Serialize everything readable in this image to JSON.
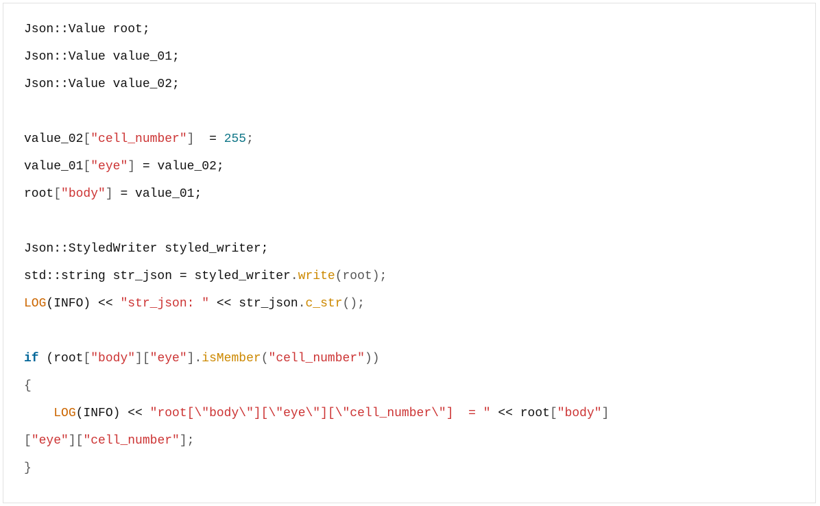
{
  "code": {
    "l1": {
      "a": "Json::Value root;"
    },
    "l2": {
      "a": "Json::Value value_01;"
    },
    "l3": {
      "a": "Json::Value value_02;"
    },
    "l4": {
      "a": ""
    },
    "l5": {
      "a": "value_02",
      "b": "[",
      "c": "\"cell_number\"",
      "d": "]",
      "e": "  = ",
      "f": "255",
      "g": ";"
    },
    "l6": {
      "a": "value_01",
      "b": "[",
      "c": "\"eye\"",
      "d": "]",
      "e": " = value_02;"
    },
    "l7": {
      "a": "root",
      "b": "[",
      "c": "\"body\"",
      "d": "]",
      "e": " = value_01;"
    },
    "l8": {
      "a": ""
    },
    "l9": {
      "a": "Json::StyledWriter styled_writer;"
    },
    "l10": {
      "a": "std::string str_json = styled_writer",
      "b": ".",
      "c": "write",
      "d": "(root);"
    },
    "l11": {
      "a": "LOG",
      "b": "(INFO) << ",
      "c": "\"str_json: \"",
      "d": " << str_json",
      "e": ".",
      "f": "c_str",
      "g": "();"
    },
    "l12": {
      "a": ""
    },
    "l13": {
      "a": "if",
      "b": " (root",
      "c": "[",
      "d": "\"body\"",
      "e": "][",
      "f": "\"eye\"",
      "g": "].",
      "h": "isMember",
      "i": "(",
      "j": "\"cell_number\"",
      "k": "))"
    },
    "l14": {
      "a": "{"
    },
    "l15": {
      "a": "    ",
      "b": "LOG",
      "c": "(INFO) << ",
      "d": "\"root[\\\"body\\\"][\\\"eye\\\"][\\\"cell_number\\\"]  = \"",
      "e": " << root",
      "f": "[",
      "g": "\"body\"",
      "h": "]"
    },
    "l16": {
      "a": "[",
      "b": "\"eye\"",
      "c": "][",
      "d": "\"cell_number\"",
      "e": "];"
    },
    "l17": {
      "a": "}"
    }
  }
}
